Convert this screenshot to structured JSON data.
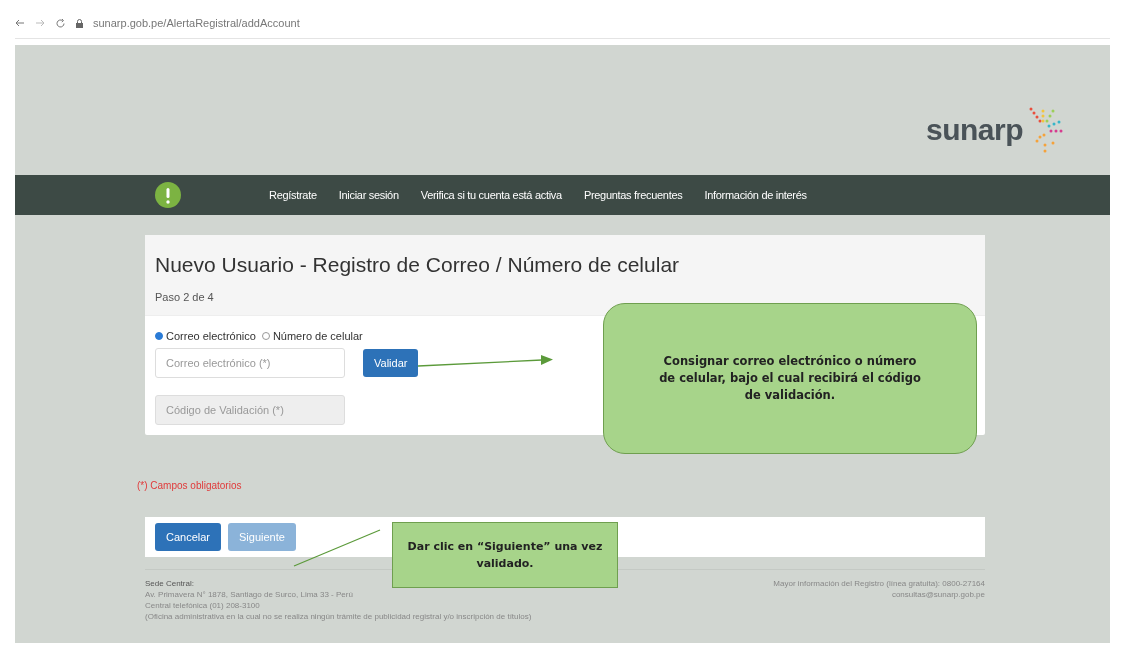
{
  "browser": {
    "url": "sunarp.gob.pe/AlertaRegistral/addAccount"
  },
  "logo": {
    "name": "sunarp"
  },
  "nav": {
    "items": [
      {
        "label": "Regístrate"
      },
      {
        "label": "Iniciar sesión"
      },
      {
        "label": "Verifica si tu cuenta está activa"
      },
      {
        "label": "Preguntas frecuentes"
      },
      {
        "label": "Información de interés"
      }
    ]
  },
  "form": {
    "title": "Nuevo Usuario - Registro de Correo / Número de celular",
    "step": "Paso 2 de 4",
    "contact_options": [
      {
        "label": "Correo electrónico",
        "selected": true
      },
      {
        "label": "Número de celular",
        "selected": false
      }
    ],
    "email_field": {
      "placeholder": "Correo electrónico (*)"
    },
    "validate_button": "Validar",
    "code_field": {
      "placeholder": "Código de Validación (*)",
      "disabled": true
    }
  },
  "required_note": "(*) Campos obligatorios",
  "buttons": [
    {
      "label": "Cancelar",
      "disabled": false
    },
    {
      "label": "Siguiente",
      "disabled": true
    }
  ],
  "footer": {
    "left": [
      "Sede Central:",
      "Av. Primavera N° 1878, Santiago de Surco, Lima 33 - Perú",
      "Central telefónica (01) 208-3100",
      "(Oficina administrativa en la cual no se realiza ningún trámite de publicidad registral y/o inscripción de títulos)"
    ],
    "right": [
      "Mayor información del Registro (línea gratuita): 0800-27164",
      "consultas@sunarp.gob.pe"
    ]
  },
  "callouts": [
    {
      "text": "Consignar correo electrónico o número de celular, bajo el cual recibirá el código de validación."
    },
    {
      "text": "Dar clic en “Siguiente” una vez validado."
    }
  ]
}
